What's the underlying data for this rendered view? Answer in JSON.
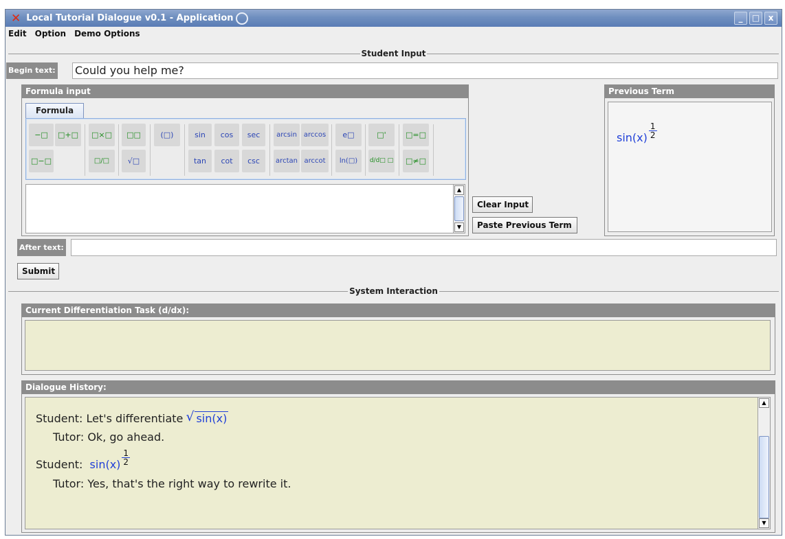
{
  "window": {
    "title": "Local Tutorial Dialogue v0.1 - Application",
    "controls": [
      "_",
      "□",
      "x"
    ]
  },
  "menu": [
    "Edit",
    "Option",
    "Demo Options"
  ],
  "student_input": {
    "group_title": "Student Input",
    "begin_label": "Begin text:",
    "begin_value": "Could you help me?",
    "formula_panel_title": "Formula input",
    "tab": "Formula",
    "palette": {
      "row1": [
        "−□",
        "□+□",
        "□×□",
        "□□",
        "(□)",
        "sin",
        "cos",
        "sec",
        "arcsin",
        "arccos",
        "e□",
        "□'",
        "□=□"
      ],
      "row2": [
        "□−□",
        "□/□",
        "√□",
        "tan",
        "cot",
        "csc",
        "arctan",
        "arccot",
        "ln(□)",
        "d/d□ □",
        "□≠□"
      ]
    },
    "clear_button": "Clear Input",
    "paste_button": "Paste Previous Term",
    "previous_term_title": "Previous Term",
    "previous_term": {
      "base": "sin(x)",
      "exp_num": "1",
      "exp_den": "2"
    },
    "after_label": "After text:",
    "after_value": ""
  },
  "submit_button": "Submit",
  "system": {
    "group_title": "System Interaction",
    "task_title": "Current Differentiation Task (d/dx):",
    "task_value": "",
    "history_title": "Dialogue History:",
    "history": {
      "l1_speaker": "Student:",
      "l1_text": "Let's differentiate",
      "l1_math": "sin(x)",
      "l2_speaker": "Tutor:",
      "l2_text": "Ok, go ahead.",
      "l3_speaker": "Student:",
      "l3_base": "sin(x)",
      "l3_num": "1",
      "l3_den": "2",
      "l4_speaker": "Tutor:",
      "l4_text": "Yes, that's the right way to rewrite it."
    }
  }
}
